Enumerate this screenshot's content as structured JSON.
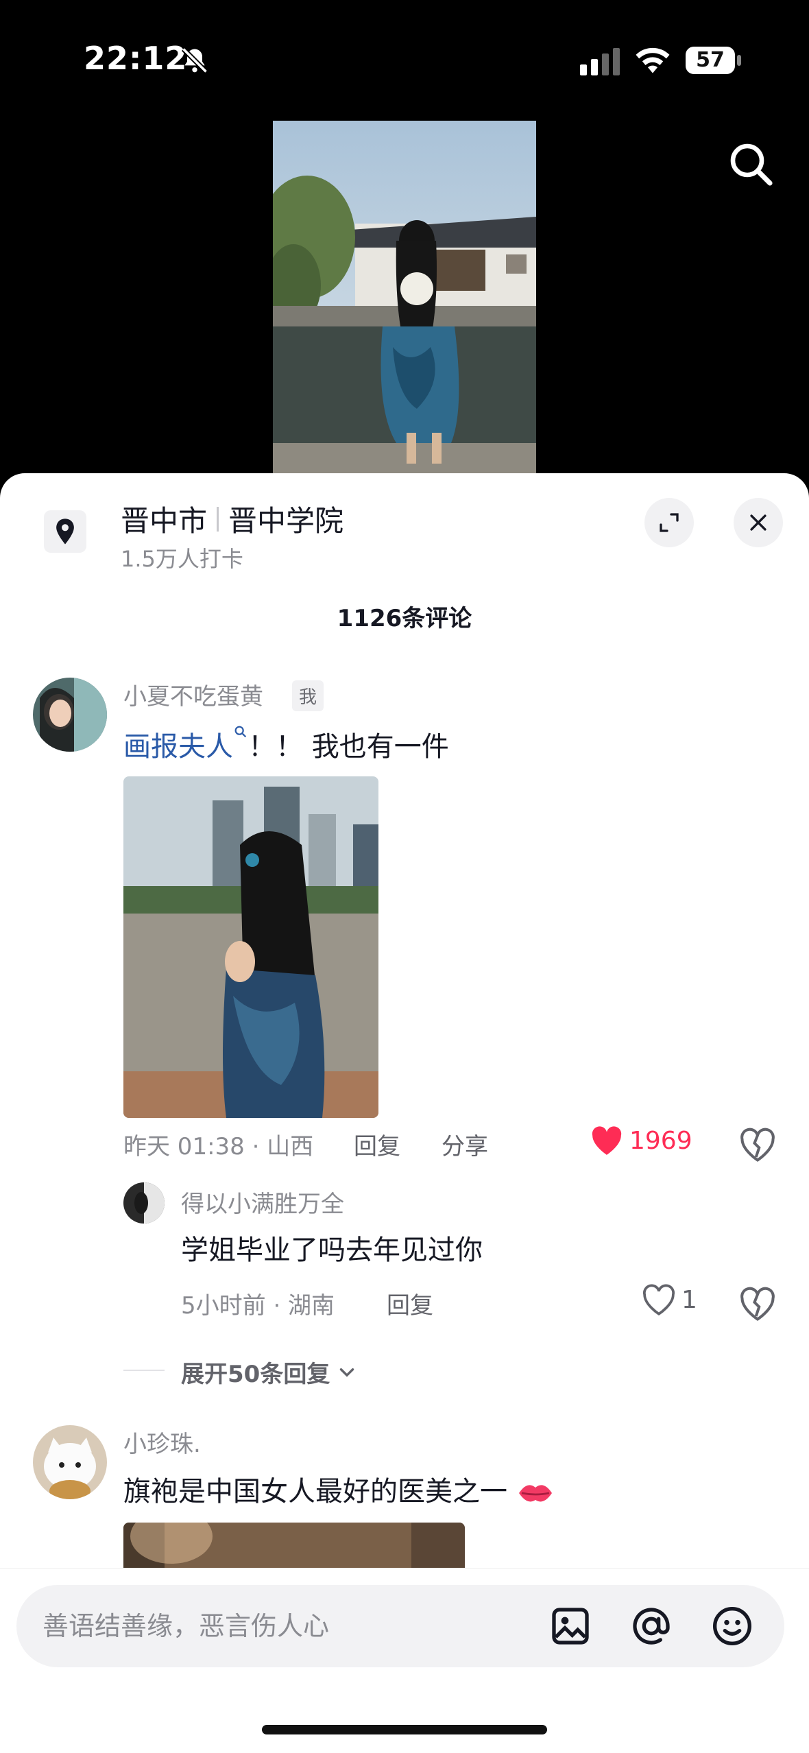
{
  "status_bar": {
    "time": "22:12",
    "battery": "57"
  },
  "location": {
    "city": "晋中市",
    "place": "晋中学院",
    "checkins": "1.5万人打卡"
  },
  "comments_count": "1126条评论",
  "comments": [
    {
      "user": "小夏不吃蛋黄",
      "tag": "我",
      "mention": "画报夫人",
      "text": "！！ 我也有一件",
      "meta": "昨天 01:38 · 山西",
      "reply_label": "回复",
      "share_label": "分享",
      "likes": "1969",
      "liked": true,
      "accent": "#fe2c55"
    },
    {
      "user": "小珍珠.",
      "text": "旗袍是中国女人最好的医美之一"
    }
  ],
  "reply": {
    "user": "得以小满胜万全",
    "text": "学姐毕业了吗去年见过你",
    "meta": "5小时前 · 湖南",
    "reply_label": "回复",
    "likes": "1"
  },
  "expand_replies": "展开50条回复",
  "input": {
    "placeholder": "善语结善缘，恶言伤人心"
  },
  "icons": [
    "bell-off-icon",
    "signal-icon",
    "wifi-icon",
    "battery-icon",
    "search-icon",
    "location-pin-icon",
    "expand-icon",
    "close-icon",
    "heart-icon",
    "dislike-icon",
    "chevron-down-icon",
    "image-icon",
    "at-icon",
    "emoji-icon",
    "kiss-emoji-icon"
  ]
}
